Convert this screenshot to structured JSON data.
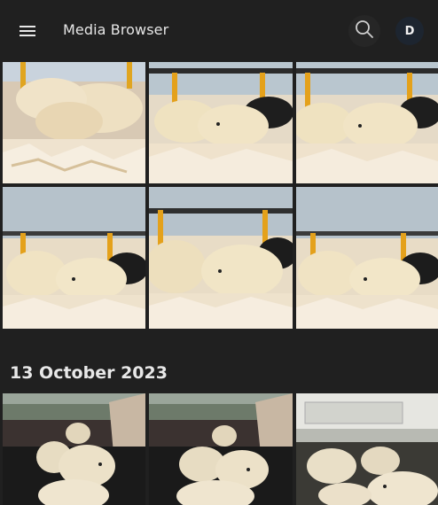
{
  "header": {
    "title": "Media Browser",
    "avatar_initial": "D"
  },
  "sections": [
    {
      "date_label": "13 October 2023"
    }
  ],
  "colors": {
    "background": "#202020",
    "avatar_bg": "#1d2530",
    "search_bg": "#262626"
  },
  "icons": [
    "menu-icon",
    "search-icon"
  ]
}
